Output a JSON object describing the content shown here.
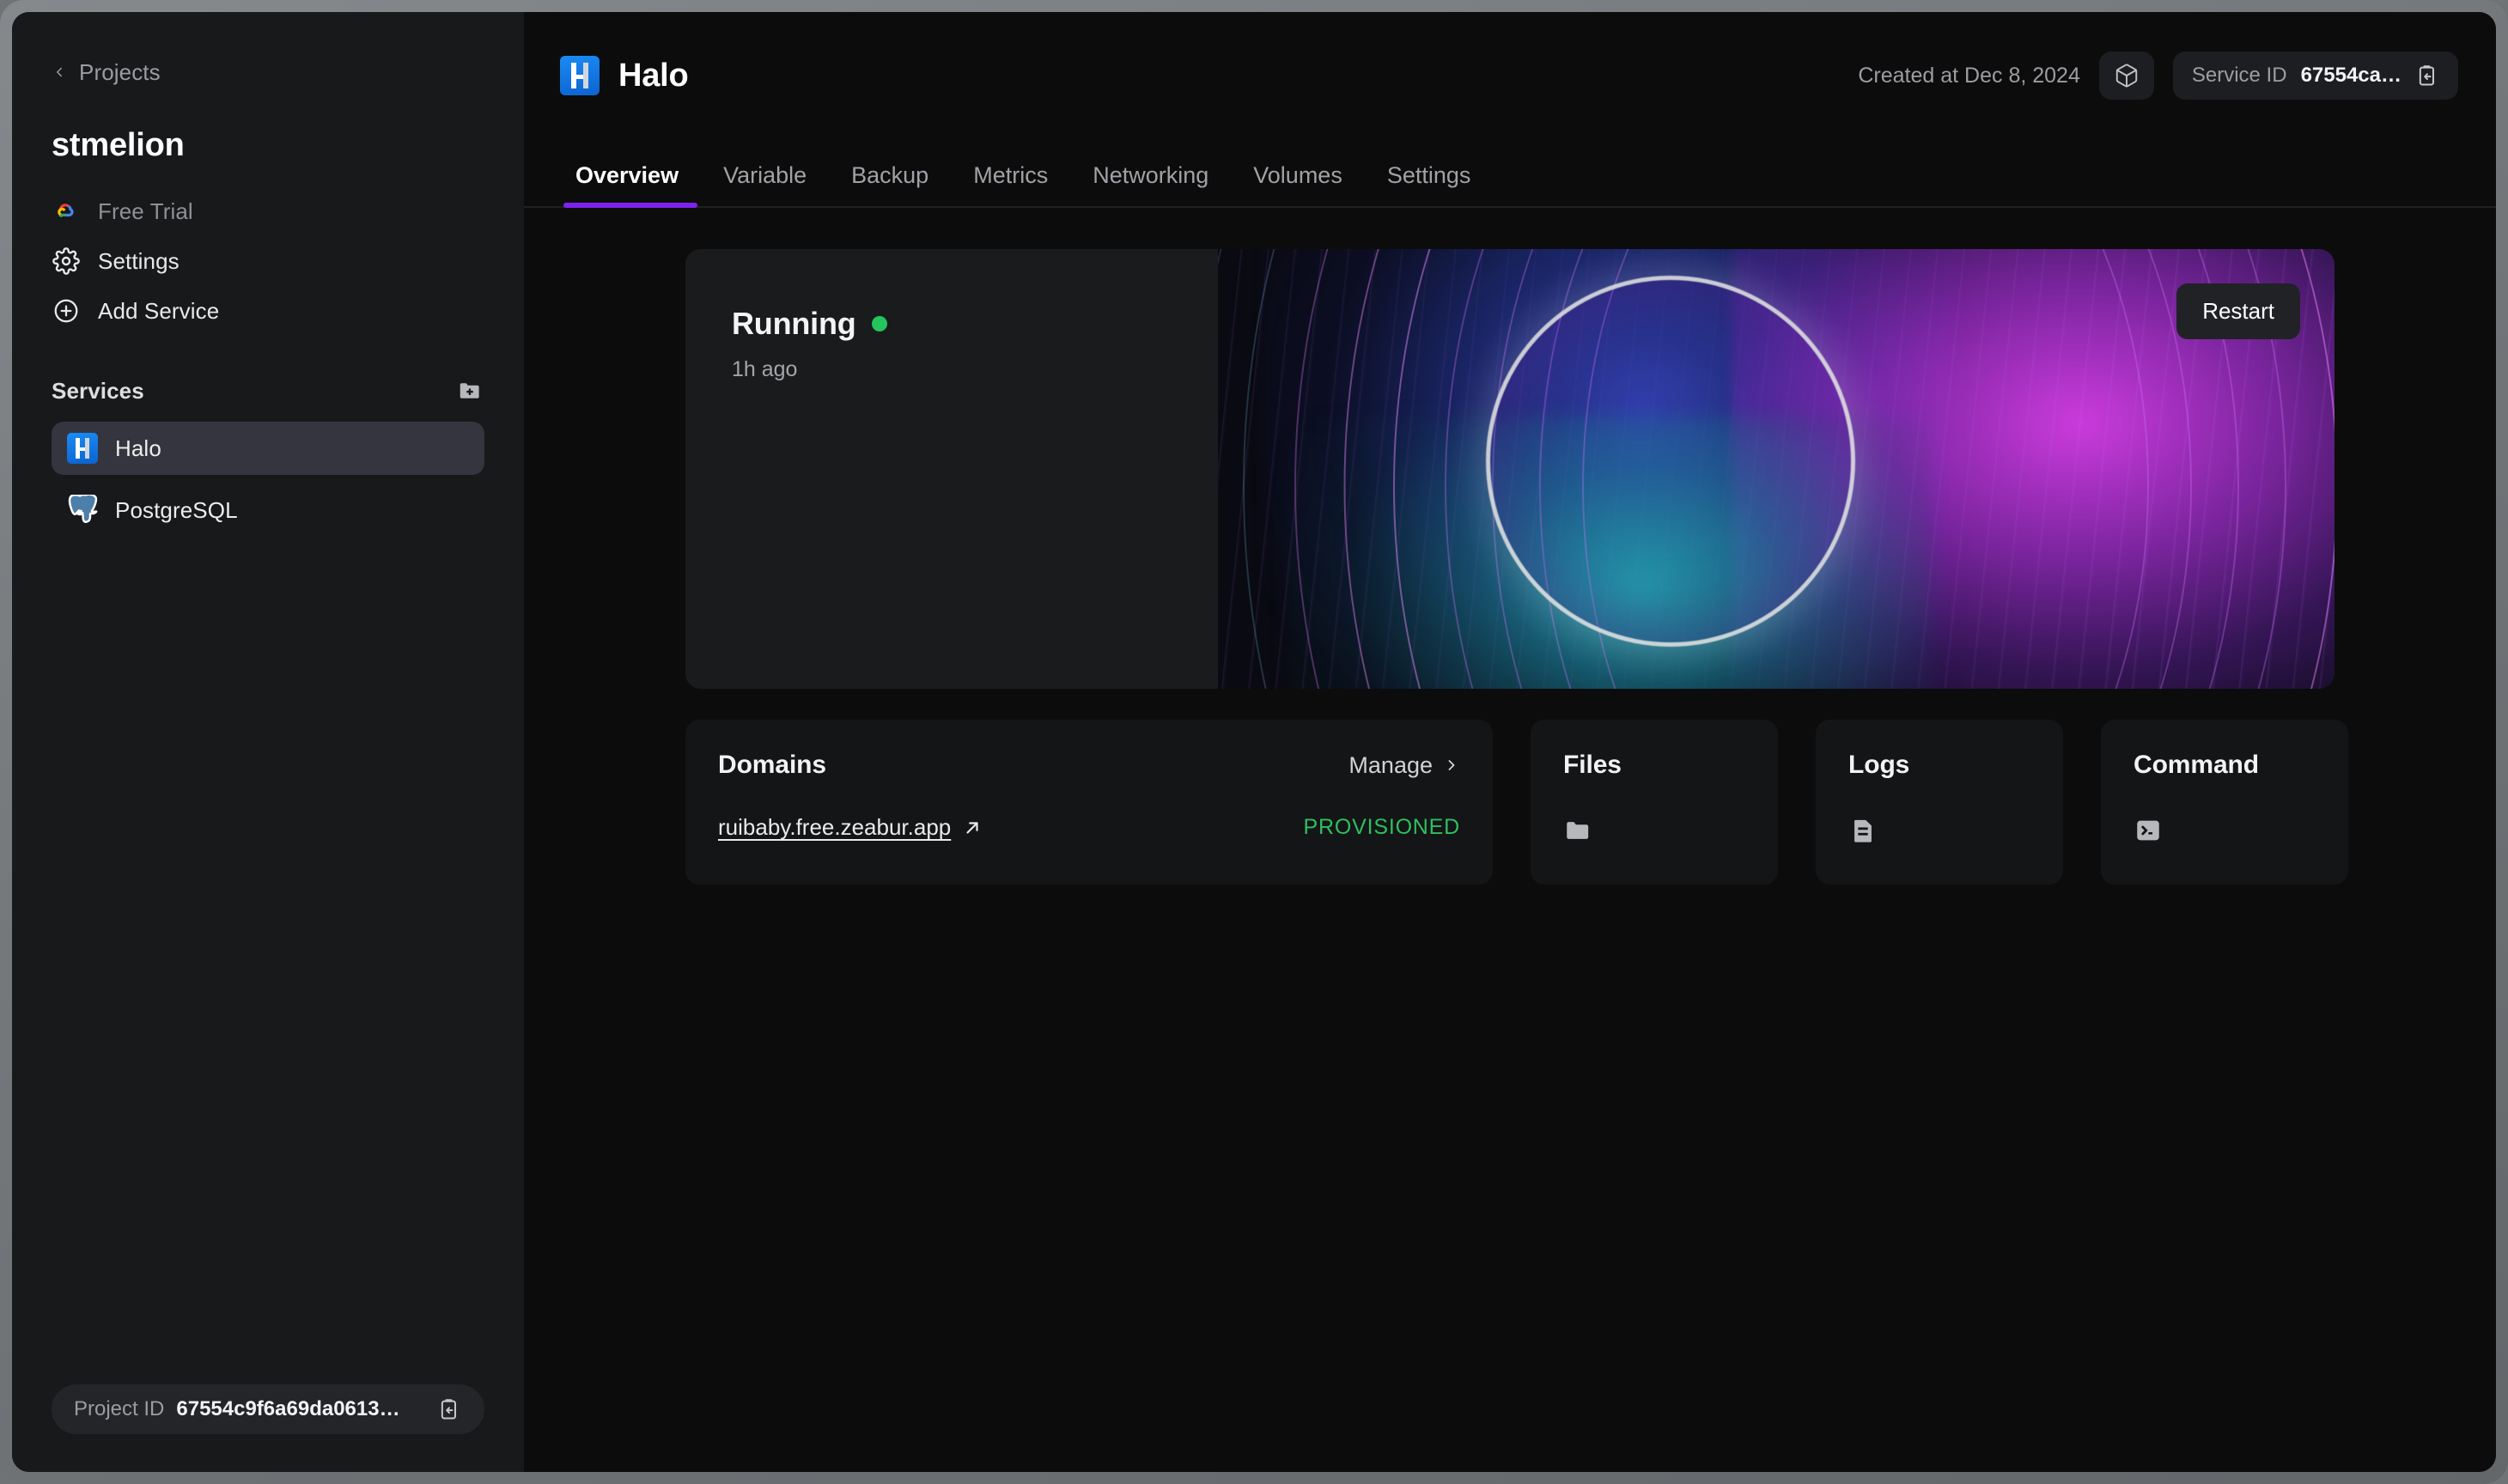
{
  "sidebar": {
    "back_label": "Projects",
    "back_icon": "chevron-left-icon",
    "project_name": "stmelion",
    "nav": [
      {
        "label": "Free Trial",
        "icon": "google-cloud-icon",
        "muted": true
      },
      {
        "label": "Settings",
        "icon": "gear-icon",
        "muted": false
      },
      {
        "label": "Add Service",
        "icon": "plus-circle-icon",
        "muted": false
      }
    ],
    "services_title": "Services",
    "services_action_icon": "folder-plus-icon",
    "services": [
      {
        "label": "Halo",
        "icon": "halo-icon",
        "active": true
      },
      {
        "label": "PostgreSQL",
        "icon": "postgresql-icon",
        "active": false
      }
    ],
    "project_id": {
      "key": "Project ID",
      "value": "67554c9f6a69da0613…",
      "copy_icon": "copy-clipboard-icon"
    }
  },
  "header": {
    "service_icon": "halo-icon",
    "title": "Halo",
    "created_text": "Created at Dec 8, 2024",
    "cube_icon": "cube-icon",
    "service_id": {
      "key": "Service ID",
      "value": "67554ca…",
      "copy_icon": "copy-clipboard-icon"
    }
  },
  "tabs": [
    {
      "label": "Overview",
      "active": true
    },
    {
      "label": "Variable",
      "active": false
    },
    {
      "label": "Backup",
      "active": false
    },
    {
      "label": "Metrics",
      "active": false
    },
    {
      "label": "Networking",
      "active": false
    },
    {
      "label": "Volumes",
      "active": false
    },
    {
      "label": "Settings",
      "active": false
    }
  ],
  "hero": {
    "status": "Running",
    "status_color": "#24c55e",
    "status_sub": "1h ago",
    "restart_label": "Restart"
  },
  "cards": {
    "domains": {
      "title": "Domains",
      "manage_label": "Manage",
      "manage_icon": "chevron-right-icon",
      "domain": "ruibaby.free.zeabur.app",
      "domain_external_icon": "external-link-icon",
      "status": "PROVISIONED",
      "status_color": "#2fbf5f"
    },
    "files": {
      "title": "Files",
      "icon": "folder-icon"
    },
    "logs": {
      "title": "Logs",
      "icon": "document-icon"
    },
    "command": {
      "title": "Command",
      "icon": "terminal-icon"
    }
  },
  "theme": {
    "accent": "#7c22f0",
    "sidebar_bg": "#18191b",
    "main_bg": "#0c0c0d",
    "card_bg": "#141517"
  }
}
